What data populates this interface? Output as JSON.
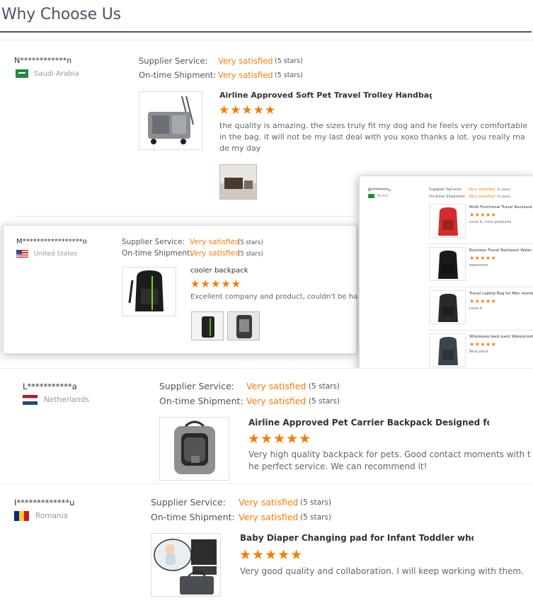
{
  "header": {
    "title": "Why Choose Us"
  },
  "labels": {
    "supplier_service": "Supplier Service:",
    "ontime_shipment": "On-time Shipment:",
    "very_satisfied": "Very satisfied",
    "five_stars": "(5 stars)",
    "star_glyphs": "★★★★★"
  },
  "reviews": {
    "saudi": {
      "buyer": "N************n",
      "country": "Saudi Arabia",
      "product_title": "Airline Approved Soft Pet Travel Trolley Handbag Dog ...",
      "rating": 5,
      "comment": "the quality is amazing. the sizes truly fit my dog and he feels very comfortable in the bag. it will not be my last deal with you xoxo thanks a lot.  you really made my day"
    },
    "us": {
      "buyer": "M*****************o",
      "country": "United States",
      "product_title": "cooler backpack",
      "rating": 5,
      "comment": "Excellent company and product, couldn't be happier"
    },
    "brazil": {
      "buyer": "B********u",
      "country": "Brazil",
      "items": [
        {
          "title": "Multi Functional Travel Rucksack",
          "comment": "Love it, nice products",
          "rating": 5,
          "color": "#d42c2c"
        },
        {
          "title": "Business Travel Backpack Water",
          "comment": "awesome",
          "rating": 5,
          "color": "#1a1a1a"
        },
        {
          "title": "Travel Laptop Bag for Men wome",
          "comment": "Love it",
          "rating": 5,
          "color": "#2a2a2a"
        },
        {
          "title": "Wholesale back pack Waterproof",
          "comment": "Nice pack",
          "rating": 5,
          "color": "#3c4250"
        }
      ]
    },
    "netherlands": {
      "buyer": "L***********a",
      "country": "Netherlands",
      "product_title": "Airline Approved Pet Carrier Backpack Designed for P...",
      "rating": 5,
      "comment": "Very high quality backpack for pets. Good contact moments with the perfect service. We can recommend it!"
    },
    "romania": {
      "buyer": "I*************u",
      "country": "Romania",
      "product_title": "Baby Diaper Changing pad for Infant Toddler wholesal...",
      "rating": 5,
      "comment": "Very good quality and collaboration. I will keep working with them."
    }
  },
  "colors": {
    "accent": "#f77c05",
    "heading": "#4a5566"
  }
}
